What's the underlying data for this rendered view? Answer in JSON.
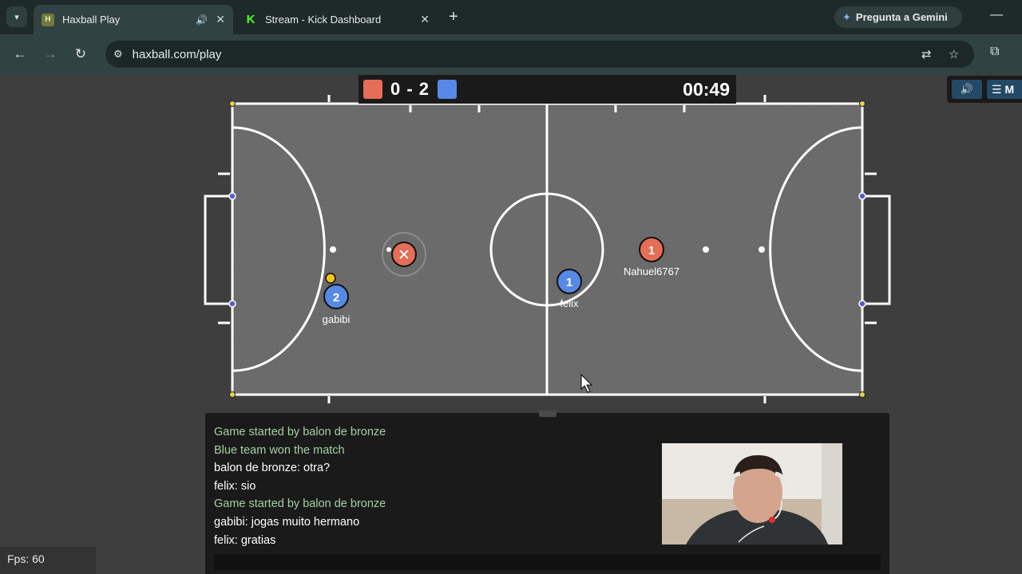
{
  "browser": {
    "tabs": [
      {
        "title": "Haxball Play",
        "favicon": "haxball-favicon",
        "audio_icon": "speaker-icon",
        "close": "✕"
      },
      {
        "title": "Stream - Kick Dashboard",
        "favicon": "kick-favicon",
        "close": "✕"
      }
    ],
    "favicon_letters": {
      "haxball": "H",
      "kick": "K"
    },
    "new_tab": "+",
    "gemini_label": "Pregunta a Gemini",
    "url": "haxball.com/play"
  },
  "scoreboard": {
    "score": "0 - 2",
    "time": "00:49",
    "red_color": "#e56e56",
    "blue_color": "#5689e5"
  },
  "controls": {
    "sound_icon": "🔊",
    "menu_label": "☰ M"
  },
  "players": [
    {
      "number": "1",
      "name": "Nahuel6767",
      "team": "red"
    },
    {
      "number": "1",
      "name": "felix",
      "team": "blue"
    },
    {
      "number": "2",
      "name": "gabibi",
      "team": "blue"
    },
    {
      "number": "",
      "name": "",
      "team": "red",
      "note": "player-with-x-avatar"
    }
  ],
  "chat": {
    "lines": [
      {
        "text": "Game started by balon de bronze",
        "type": "notice"
      },
      {
        "text": "Blue team won the match",
        "type": "notice"
      },
      {
        "text": "balon de bronze: otra?",
        "type": "message"
      },
      {
        "text": "felix: sio",
        "type": "message"
      },
      {
        "text": "Game started by balon de bronze",
        "type": "notice"
      },
      {
        "text": "gabibi: jogas muito hermano",
        "type": "message"
      },
      {
        "text": "felix: gratias",
        "type": "message"
      }
    ],
    "input_value": ""
  },
  "fps_label": "Fps: 60"
}
